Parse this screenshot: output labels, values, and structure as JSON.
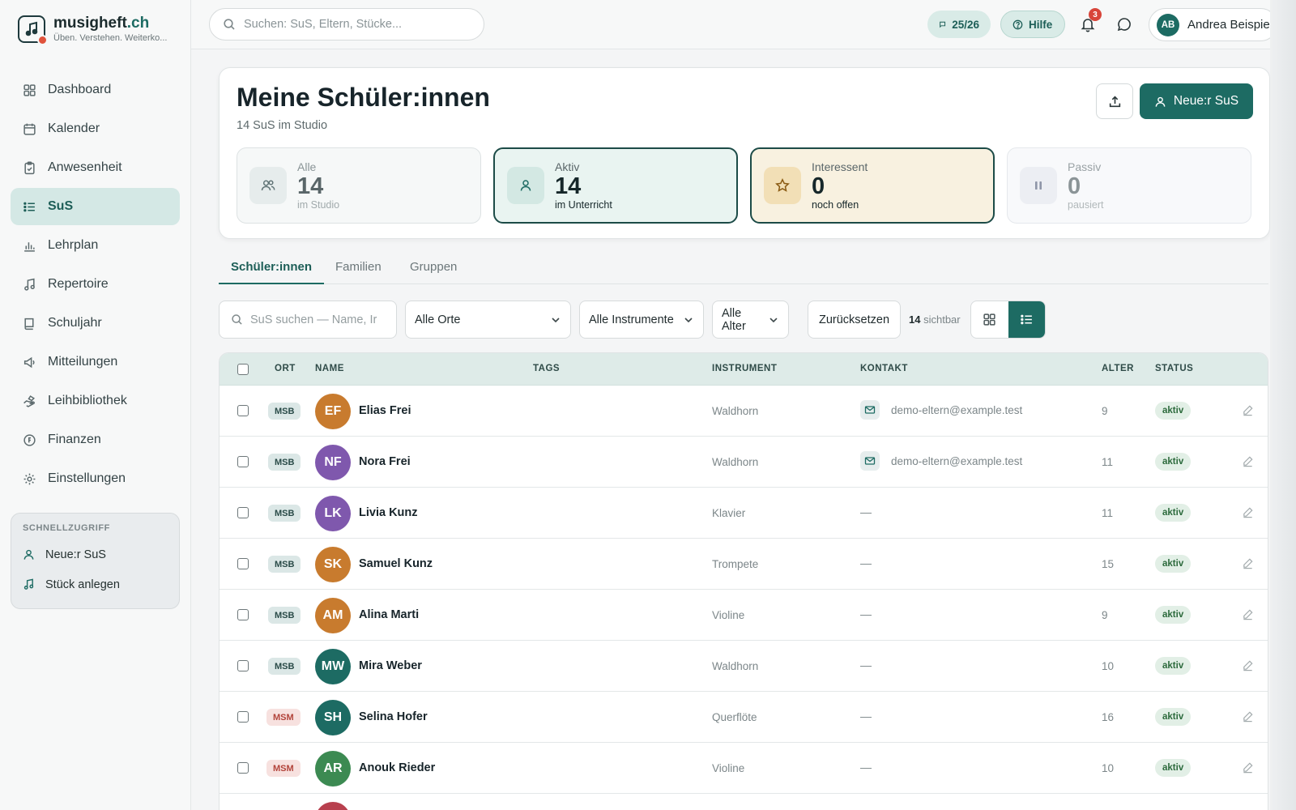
{
  "brand": {
    "name_main": "musigheft",
    "name_accent": ".ch",
    "tagline": "Üben. Verstehen. Weiterko..."
  },
  "sidebar": {
    "items": [
      {
        "label": "Dashboard",
        "icon": "grid-icon"
      },
      {
        "label": "Kalender",
        "icon": "calendar-icon"
      },
      {
        "label": "Anwesenheit",
        "icon": "clipboard-icon"
      },
      {
        "label": "SuS",
        "icon": "list-icon",
        "active": true
      },
      {
        "label": "Lehrplan",
        "icon": "bar-chart-icon"
      },
      {
        "label": "Repertoire",
        "icon": "music-note-icon"
      },
      {
        "label": "Schuljahr",
        "icon": "book-icon"
      },
      {
        "label": "Mitteilungen",
        "icon": "megaphone-icon"
      },
      {
        "label": "Leihbibliothek",
        "icon": "hand-icon"
      },
      {
        "label": "Finanzen",
        "icon": "coin-icon"
      },
      {
        "label": "Einstellungen",
        "icon": "gear-icon"
      }
    ],
    "quick": {
      "title": "SCHNELLZUGRIFF",
      "items": [
        {
          "label": "Neue:r SuS",
          "icon": "user-icon"
        },
        {
          "label": "Stück anlegen",
          "icon": "music-note-icon"
        }
      ]
    }
  },
  "topbar": {
    "search_placeholder": "Suchen: SuS, Eltern, Stücke...",
    "year": "25/26",
    "help": "Hilfe",
    "notifications": "3",
    "user_initials": "AB",
    "user_name": "Andrea Beispiel"
  },
  "header": {
    "title": "Meine Schüler:innen",
    "subtitle": "14 SuS im Studio",
    "new_button": "Neue:r SuS",
    "stats": [
      {
        "label": "Alle",
        "value": "14",
        "note": "im Studio"
      },
      {
        "label": "Aktiv",
        "value": "14",
        "note": "im Unterricht"
      },
      {
        "label": "Interessent",
        "value": "0",
        "note": "noch offen"
      },
      {
        "label": "Passiv",
        "value": "0",
        "note": "pausiert"
      }
    ]
  },
  "tabs": [
    "Schüler:innen",
    "Familien",
    "Gruppen"
  ],
  "filters": {
    "search_placeholder": "SuS suchen — Name, Ir",
    "orte": "Alle Orte",
    "instrumente": "Alle Instrumente",
    "alter": "Alle Alter",
    "reset": "Zurücksetzen",
    "visible_count": "14",
    "visible_label": "sichtbar"
  },
  "table": {
    "headers": [
      "ORT",
      "NAME",
      "TAGS",
      "INSTRUMENT",
      "KONTAKT",
      "ALTER",
      "STATUS"
    ],
    "rows": [
      {
        "ort": "MSB",
        "initials": "EF",
        "color": "#c87b2e",
        "name": "Elias Frei",
        "instrument": "Waldhorn",
        "contact": "demo-eltern@example.test",
        "age": "9",
        "status": "aktiv"
      },
      {
        "ort": "MSB",
        "initials": "NF",
        "color": "#7f58ad",
        "name": "Nora Frei",
        "instrument": "Waldhorn",
        "contact": "demo-eltern@example.test",
        "age": "11",
        "status": "aktiv"
      },
      {
        "ort": "MSB",
        "initials": "LK",
        "color": "#7f58ad",
        "name": "Livia Kunz",
        "instrument": "Klavier",
        "contact": "—",
        "age": "11",
        "status": "aktiv"
      },
      {
        "ort": "MSB",
        "initials": "SK",
        "color": "#c87b2e",
        "name": "Samuel Kunz",
        "instrument": "Trompete",
        "contact": "—",
        "age": "15",
        "status": "aktiv"
      },
      {
        "ort": "MSB",
        "initials": "AM",
        "color": "#c87b2e",
        "name": "Alina Marti",
        "instrument": "Violine",
        "contact": "—",
        "age": "9",
        "status": "aktiv"
      },
      {
        "ort": "MSB",
        "initials": "MW",
        "color": "#1d6b63",
        "name": "Mira Weber",
        "instrument": "Waldhorn",
        "contact": "—",
        "age": "10",
        "status": "aktiv"
      },
      {
        "ort": "MSM",
        "initials": "SH",
        "color": "#1d6b63",
        "name": "Selina Hofer",
        "instrument": "Querflöte",
        "contact": "—",
        "age": "16",
        "status": "aktiv"
      },
      {
        "ort": "MSM",
        "initials": "AR",
        "color": "#3c8a52",
        "name": "Anouk Rieder",
        "instrument": "Violine",
        "contact": "—",
        "age": "10",
        "status": "aktiv"
      }
    ],
    "partial_row_color": "#b8404e"
  }
}
